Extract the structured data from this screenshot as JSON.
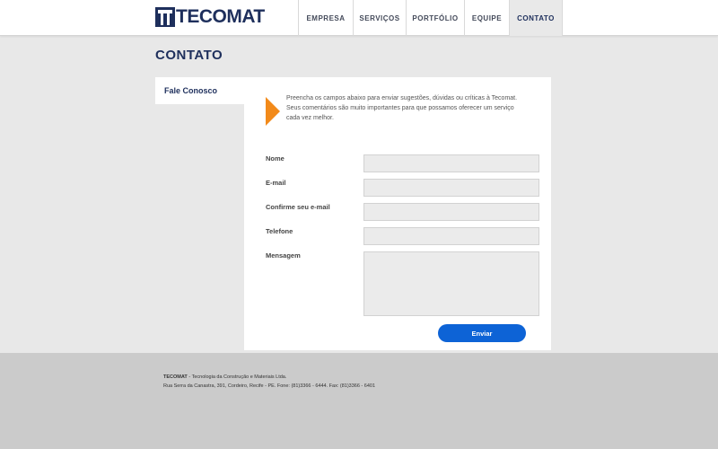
{
  "header": {
    "logo_text": "TECOMAT",
    "nav": [
      {
        "label": "EMPRESA"
      },
      {
        "label": "SERVIÇOS"
      },
      {
        "label": "PORTFÓLIO"
      },
      {
        "label": "EQUIPE"
      },
      {
        "label": "CONTATO"
      }
    ],
    "active_nav": "CONTATO"
  },
  "page": {
    "title": "CONTATO",
    "side_tab": "Fale Conosco"
  },
  "intro": {
    "line1": "Preencha os campos abaixo para enviar sugestões, dúvidas ou críticas à Tecomat.",
    "line2": "Seus comentários são muito importantes para que possamos oferecer um serviço cada vez melhor."
  },
  "form": {
    "fields": [
      {
        "label": "Nome",
        "value": ""
      },
      {
        "label": "E-mail",
        "value": ""
      },
      {
        "label": "Confirme seu e-mail",
        "value": ""
      },
      {
        "label": "Telefone",
        "value": ""
      },
      {
        "label": "Mensagem",
        "value": ""
      }
    ],
    "submit_label": "Enviar"
  },
  "footer": {
    "company": "TECOMAT",
    "company_desc": " - Tecnologia da Construção e Materiais Ltda.",
    "address": "Rua Serra da Canastra, 391, Cordeiro, Recife - PE. Fone: (81)3366 - 6444. Fax: (81)3366 - 6401"
  },
  "colors": {
    "brand": "#1e2f5c",
    "accent": "#f28a1a",
    "button": "#0d63d6"
  }
}
